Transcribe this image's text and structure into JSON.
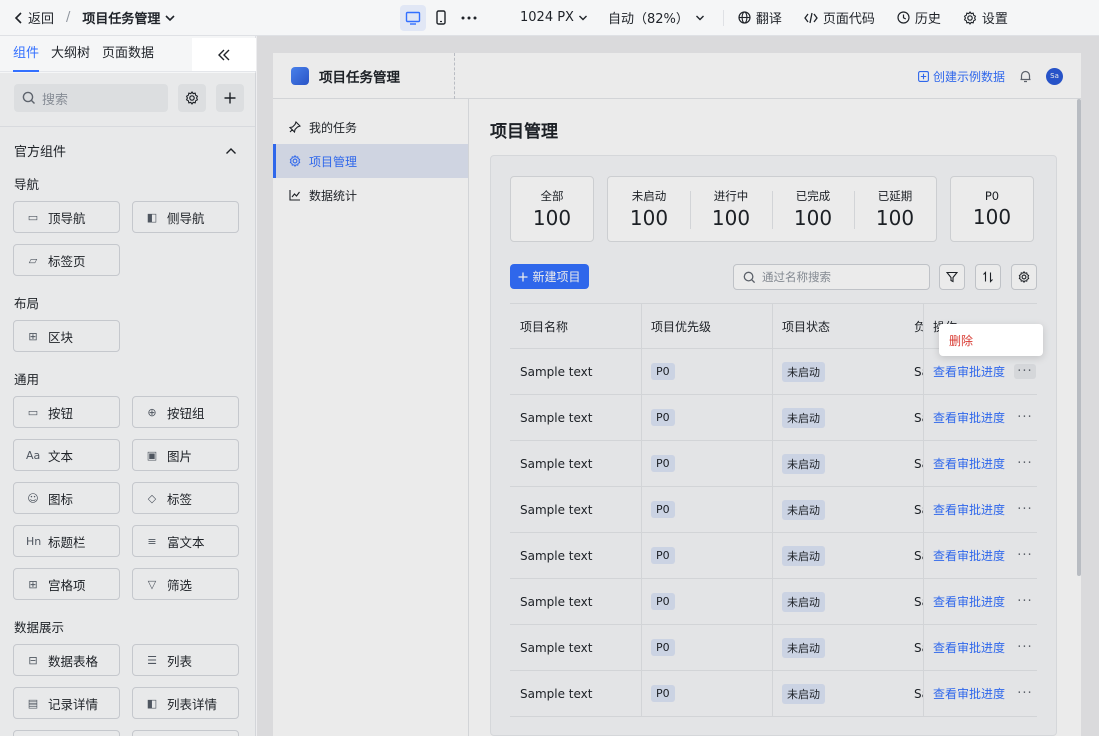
{
  "topbar": {
    "back_label": "返回",
    "separator": "/",
    "app_title": "项目任务管理",
    "screen_size": "1024 PX",
    "zoom": "自动（82%）",
    "actions": [
      {
        "label": "翻译",
        "icon": "globe-icon"
      },
      {
        "label": "页面代码",
        "icon": "code-icon"
      },
      {
        "label": "历史",
        "icon": "history-icon"
      },
      {
        "label": "设置",
        "icon": "gear-icon"
      }
    ]
  },
  "left_panel": {
    "tabs": [
      "组件",
      "大纲树",
      "页面数据"
    ],
    "active_tab": "组件",
    "search_placeholder": "搜索",
    "section_title": "官方组件",
    "groups": [
      {
        "title": "导航",
        "items": [
          {
            "label": "顶导航",
            "icon": "top-nav-icon"
          },
          {
            "label": "侧导航",
            "icon": "side-nav-icon"
          },
          {
            "label": "标签页",
            "icon": "folder-icon"
          }
        ]
      },
      {
        "title": "布局",
        "items": [
          {
            "label": "区块",
            "icon": "grid-icon"
          }
        ]
      },
      {
        "title": "通用",
        "items": [
          {
            "label": "按钮",
            "icon": "button-icon"
          },
          {
            "label": "按钮组",
            "icon": "button-group-icon"
          },
          {
            "label": "文本",
            "icon": "text-icon"
          },
          {
            "label": "图片",
            "icon": "image-icon"
          },
          {
            "label": "图标",
            "icon": "smile-icon"
          },
          {
            "label": "标签",
            "icon": "tag-icon"
          },
          {
            "label": "标题栏",
            "icon": "heading-icon"
          },
          {
            "label": "富文本",
            "icon": "rich-text-icon"
          },
          {
            "label": "宫格项",
            "icon": "grid-item-icon"
          },
          {
            "label": "筛选",
            "icon": "filter-icon"
          }
        ]
      },
      {
        "title": "数据展示",
        "items": [
          {
            "label": "数据表格",
            "icon": "table-icon"
          },
          {
            "label": "列表",
            "icon": "list-icon"
          },
          {
            "label": "记录详情",
            "icon": "record-icon"
          },
          {
            "label": "列表详情",
            "icon": "list-detail-icon"
          }
        ]
      }
    ]
  },
  "app": {
    "title": "项目任务管理",
    "create_sample": "创建示例数据",
    "avatar_text": "Sa",
    "nav": [
      {
        "label": "我的任务",
        "icon": "pin-icon",
        "active": false
      },
      {
        "label": "项目管理",
        "icon": "gear-icon",
        "active": true
      },
      {
        "label": "数据统计",
        "icon": "chart-icon",
        "active": false
      }
    ],
    "page_title": "项目管理",
    "stats_group1": [
      {
        "label": "全部",
        "value": "100"
      }
    ],
    "stats_group2": [
      {
        "label": "未启动",
        "value": "100"
      },
      {
        "label": "进行中",
        "value": "100"
      },
      {
        "label": "已完成",
        "value": "100"
      },
      {
        "label": "已延期",
        "value": "100"
      }
    ],
    "stats_group3": [
      {
        "label": "P0",
        "value": "100"
      }
    ],
    "new_button": "新建项目",
    "search_placeholder": "通过名称搜索",
    "table": {
      "headers": [
        "项目名称",
        "项目优先级",
        "项目状态",
        "负",
        "操作"
      ],
      "rows": [
        {
          "name": "Sample text",
          "priority": "P0",
          "status": "未启动",
          "owner": "Sa",
          "action": "查看审批进度"
        },
        {
          "name": "Sample text",
          "priority": "P0",
          "status": "未启动",
          "owner": "Sa",
          "action": "查看审批进度"
        },
        {
          "name": "Sample text",
          "priority": "P0",
          "status": "未启动",
          "owner": "Sa",
          "action": "查看审批进度"
        },
        {
          "name": "Sample text",
          "priority": "P0",
          "status": "未启动",
          "owner": "Sa",
          "action": "查看审批进度"
        },
        {
          "name": "Sample text",
          "priority": "P0",
          "status": "未启动",
          "owner": "Sa",
          "action": "查看审批进度"
        },
        {
          "name": "Sample text",
          "priority": "P0",
          "status": "未启动",
          "owner": "Sa",
          "action": "查看审批进度"
        },
        {
          "name": "Sample text",
          "priority": "P0",
          "status": "未启动",
          "owner": "Sa",
          "action": "查看审批进度"
        },
        {
          "name": "Sample text",
          "priority": "P0",
          "status": "未启动",
          "owner": "Sa",
          "action": "查看审批进度"
        }
      ]
    },
    "dropdown_delete": "删除"
  },
  "colors": {
    "accent": "#3370ff",
    "danger": "#d83931",
    "tag_bg": "#dde5f7"
  }
}
